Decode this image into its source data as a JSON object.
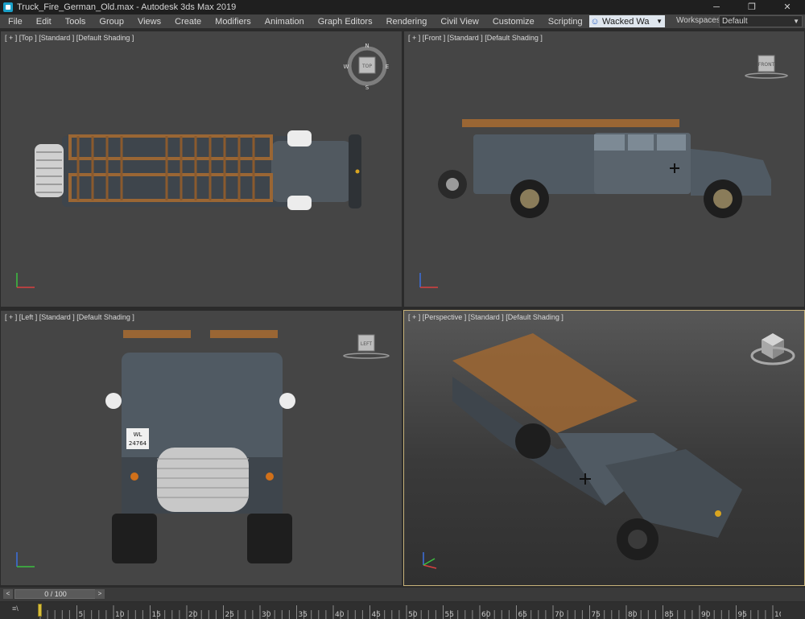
{
  "titlebar": {
    "title": "Truck_Fire_German_Old.max - Autodesk 3ds Max 2019",
    "minimize": "─",
    "restore": "❐",
    "close": "✕"
  },
  "menu": {
    "items": [
      "File",
      "Edit",
      "Tools",
      "Group",
      "Views",
      "Create",
      "Modifiers",
      "Animation",
      "Graph Editors",
      "Rendering",
      "Civil View",
      "Customize",
      "Scripting"
    ],
    "user": "Wacked Wa",
    "workspaces_label": "Workspaces:",
    "workspace_value": "Default"
  },
  "viewports": {
    "top": {
      "label": "[ + ] [Top ] [Standard ] [Default Shading ]",
      "cube_label": "TOP",
      "compass": [
        "N",
        "E",
        "S",
        "W"
      ]
    },
    "front": {
      "label": "[ + ] [Front ] [Standard ] [Default Shading ]",
      "cube_label": "FRONT"
    },
    "left": {
      "label": "[ + ] [Left ] [Standard ] [Default Shading ]",
      "cube_label": "LEFT"
    },
    "perspective": {
      "label": "[ + ] [Perspective ] [Standard ] [Default Shading ]"
    }
  },
  "truck": {
    "plate_line1": "WL",
    "plate_line2": "24764"
  },
  "time_slider": {
    "value": "0 / 100",
    "prev": "<",
    "next": ">"
  },
  "track_bar": {
    "icon": "≡\\",
    "ticks": [
      "0",
      "5",
      "10",
      "15",
      "20",
      "25",
      "30",
      "35",
      "40",
      "45",
      "50",
      "55",
      "60",
      "65",
      "70",
      "75",
      "80",
      "85",
      "90",
      "95",
      "100"
    ],
    "current_frame": 0,
    "range": [
      0,
      100
    ]
  },
  "colors": {
    "viewport_bg": "#454545",
    "active_border": "#c8b37a",
    "truck_body": "#505a63",
    "ladder": "#8a5a2e"
  }
}
